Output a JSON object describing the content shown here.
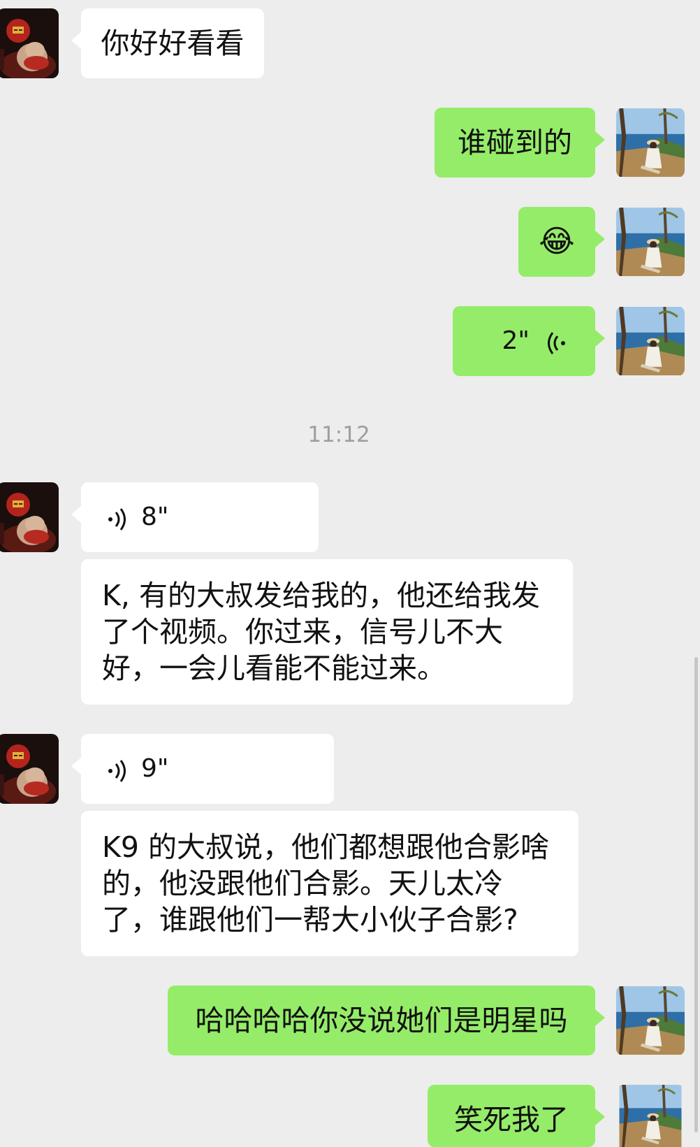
{
  "chat": {
    "messages": [
      {
        "side": "in",
        "type": "text",
        "text": "你好好看看"
      },
      {
        "side": "out",
        "type": "text",
        "text": "谁碰到的"
      },
      {
        "side": "out",
        "type": "emoji",
        "emoji": "😂",
        "icon": "tears-of-joy-emoji"
      },
      {
        "side": "out",
        "type": "voice",
        "duration": "2\""
      },
      {
        "side": "in",
        "type": "voice",
        "duration": "8\""
      },
      {
        "side": "in",
        "type": "text",
        "lines": [
          "K, 有的大叔发给我的，他还给我发",
          "了个视频。你过来，信号儿不大",
          "好，一会儿看能不能过来。"
        ]
      },
      {
        "side": "in",
        "type": "voice",
        "duration": "9\""
      },
      {
        "side": "in",
        "type": "text",
        "lines": [
          "K9 的大叔说，他们都想跟他合影啥",
          "的，他没跟他们合影。天儿太冷",
          "了，谁跟他们一帮大小伙子合影?"
        ]
      },
      {
        "side": "out",
        "type": "text",
        "text": "哈哈哈哈你没说她们是明星吗"
      },
      {
        "side": "out",
        "type": "text",
        "text": "笑死我了"
      }
    ],
    "time_divider": "11:12"
  },
  "colors": {
    "background": "#ededed",
    "incoming_bubble": "#ffffff",
    "outgoing_bubble": "#95ec69",
    "timestamp": "#9e9e9e"
  }
}
